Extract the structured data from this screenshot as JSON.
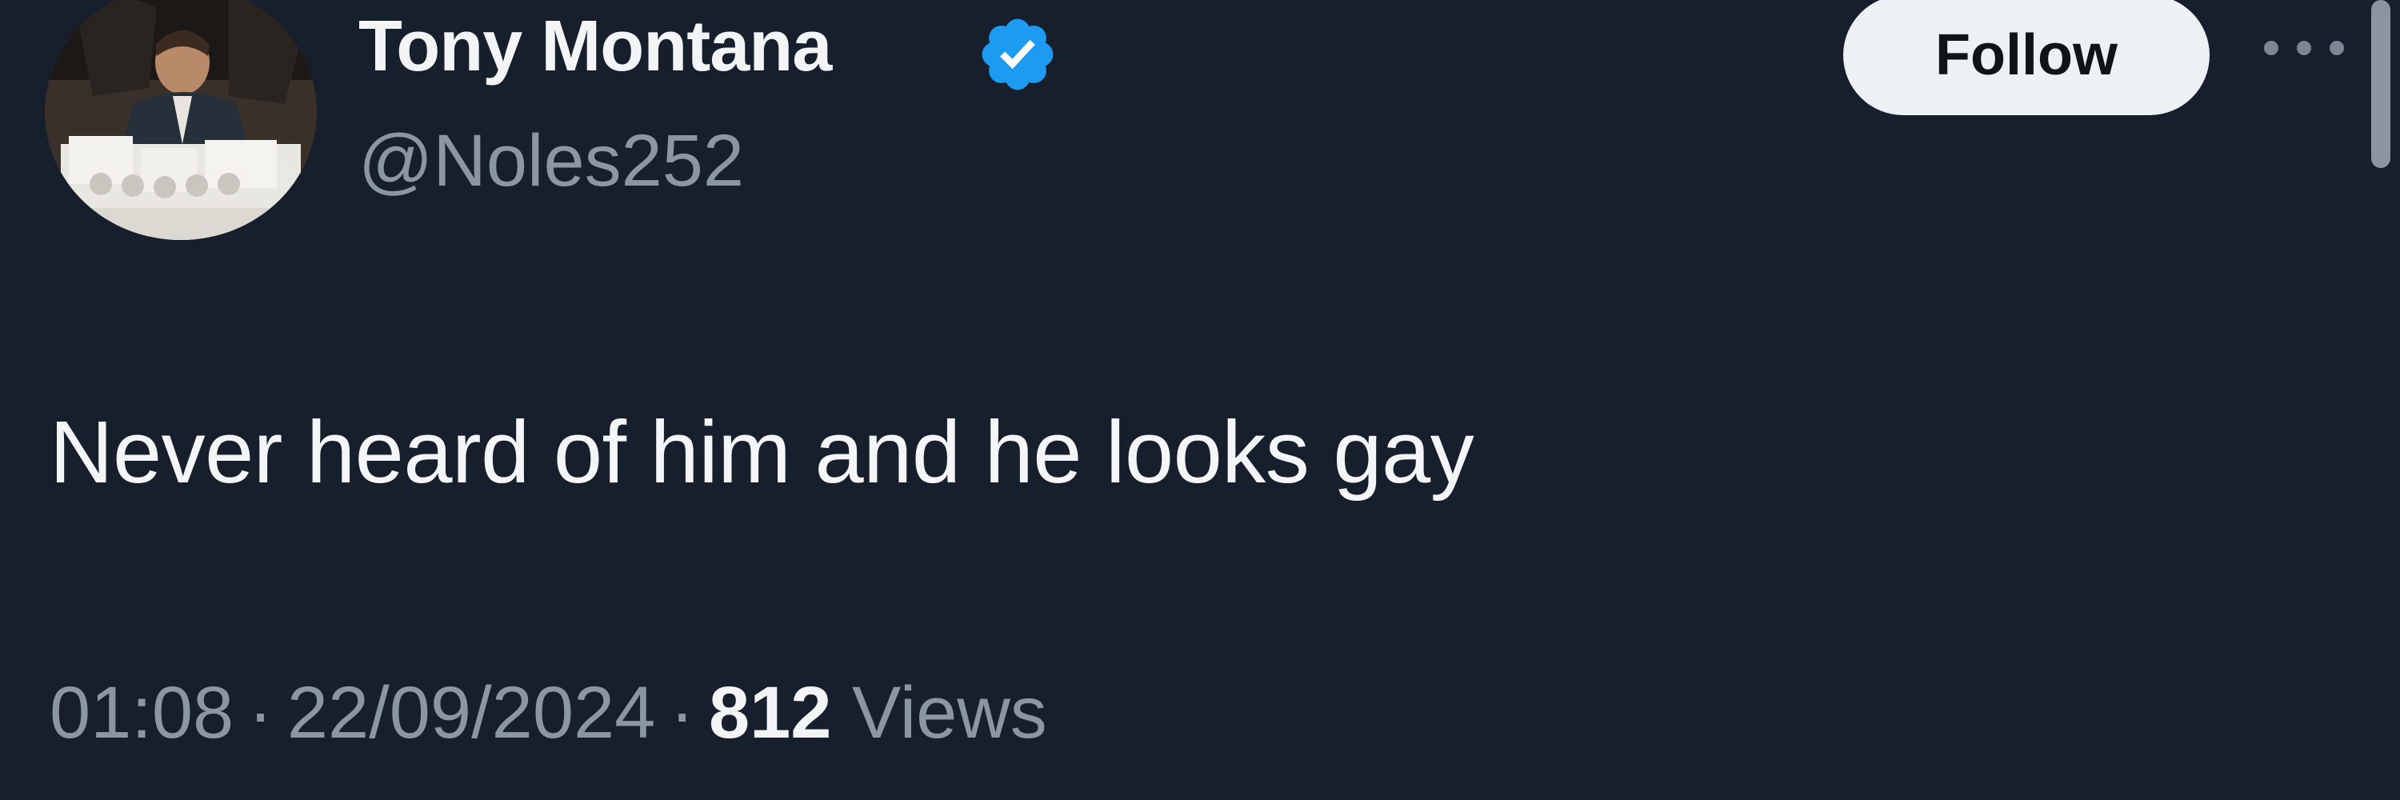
{
  "tweet": {
    "author": {
      "display_name": "Tony Montana",
      "handle": "@Noles252",
      "verified": true,
      "avatar_icon": "avatar-image"
    },
    "follow_label": "Follow",
    "more_icon": "more-options-icon",
    "text": "Never heard of him and he looks gay",
    "time": "01:08",
    "separator": "·",
    "date": "22/09/2024",
    "views_count": "812",
    "views_label": "Views"
  },
  "colors": {
    "background": "#161f2b",
    "text_primary": "#f3f4f6",
    "text_secondary": "#8b96a3",
    "verified_badge": "#1d9bf0",
    "follow_button_bg": "#eef1f4",
    "follow_button_text": "#0f1419"
  }
}
